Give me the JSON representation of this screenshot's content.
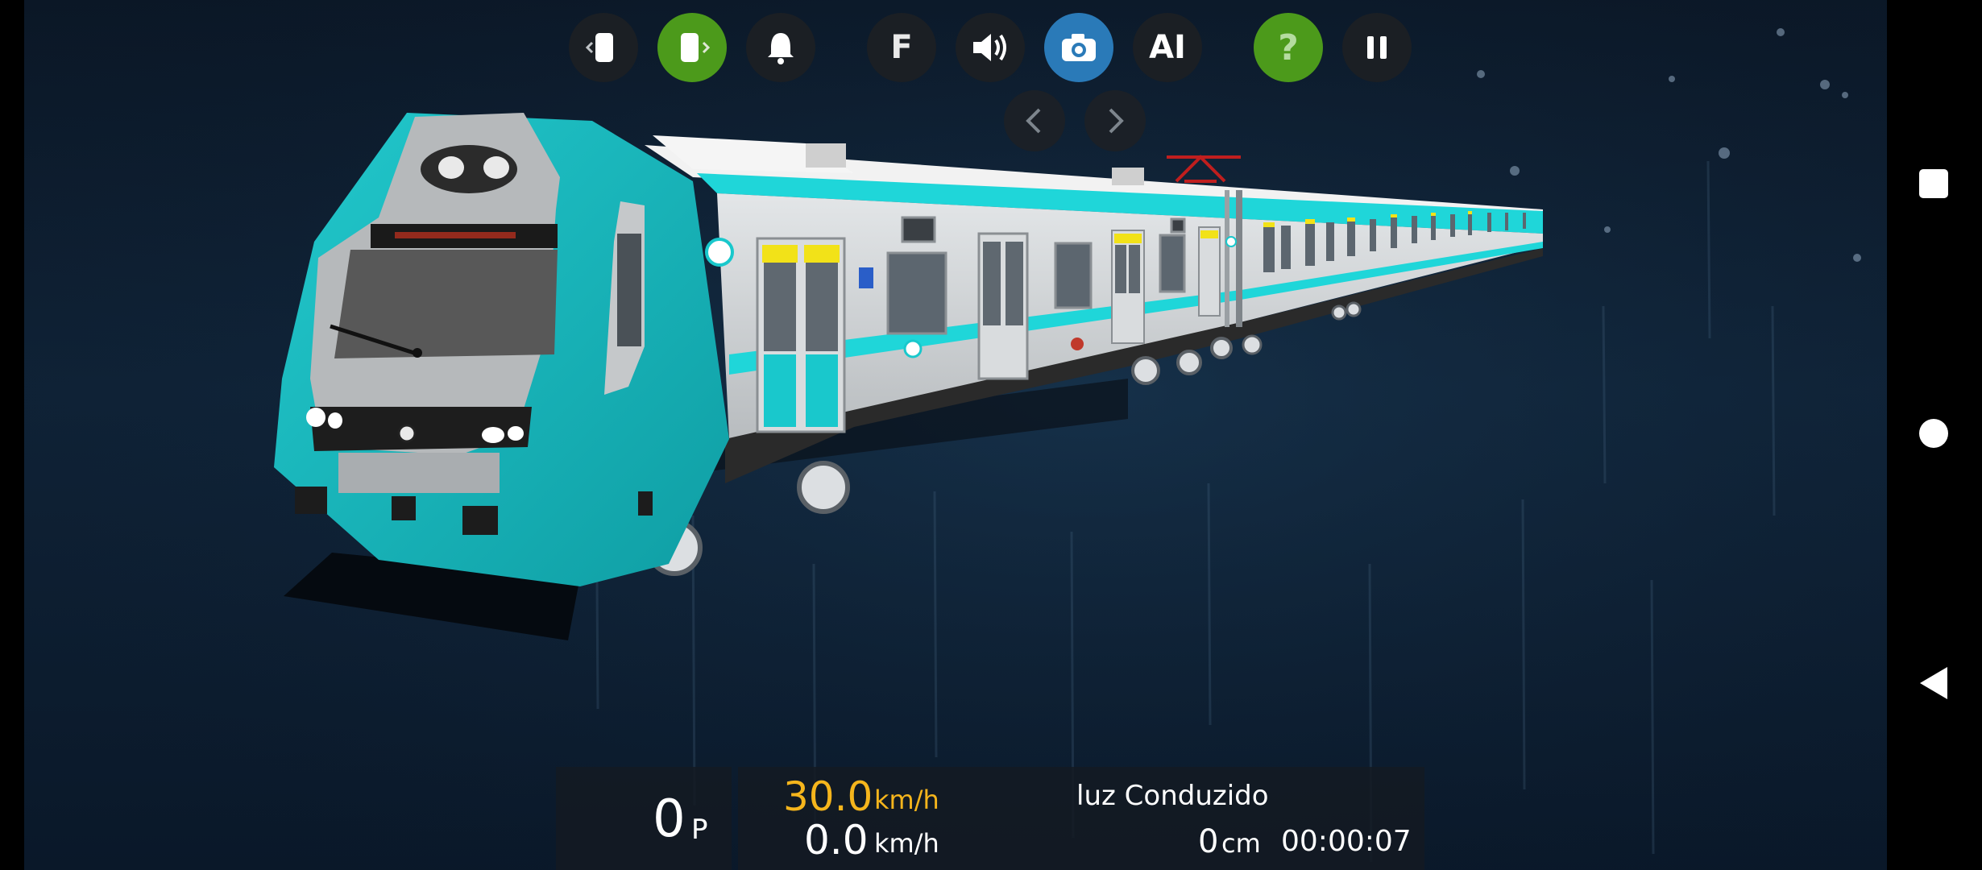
{
  "toolbar": {
    "buttons": [
      {
        "name": "camera-prev-car-button",
        "icon": "door-left-icon",
        "label": ""
      },
      {
        "name": "camera-next-car-button",
        "icon": "door-right-icon",
        "label": ""
      },
      {
        "name": "bell-button",
        "icon": "bell-icon",
        "label": ""
      },
      {
        "name": "f-button",
        "icon": "",
        "label": "F"
      },
      {
        "name": "sound-button",
        "icon": "speaker-icon",
        "label": ""
      },
      {
        "name": "camera-button",
        "icon": "camera-icon",
        "label": ""
      },
      {
        "name": "ai-button",
        "icon": "",
        "label": "AI"
      },
      {
        "name": "help-button",
        "icon": "",
        "label": "?"
      },
      {
        "name": "pause-button",
        "icon": "pause-icon",
        "label": ""
      }
    ],
    "arrows": [
      {
        "name": "camera-left-arrow",
        "icon": "chevron-left-icon"
      },
      {
        "name": "camera-right-arrow",
        "icon": "chevron-right-icon"
      }
    ]
  },
  "hud": {
    "throttle_value": "0",
    "throttle_mode": "P",
    "speed_limit_value": "30.0",
    "speed_limit_unit": "km/h",
    "current_speed_value": "0.0",
    "current_speed_unit": "km/h",
    "status_text": "luz Conduzido",
    "distance_value": "0",
    "distance_unit": "cm",
    "timer": "00:00:07"
  },
  "colors": {
    "accent_green": "#4c9a1b",
    "accent_blue": "#2a7ab8",
    "speed_limit_yellow": "#f5b51c",
    "train_teal": "#19b8be",
    "train_cyan": "#20d8db",
    "train_silver": "#cfd2d4"
  },
  "system_nav": [
    {
      "name": "nav-recents-button",
      "icon": "square-icon"
    },
    {
      "name": "nav-home-button",
      "icon": "circle-icon"
    },
    {
      "name": "nav-back-button",
      "icon": "triangle-back-icon"
    }
  ]
}
